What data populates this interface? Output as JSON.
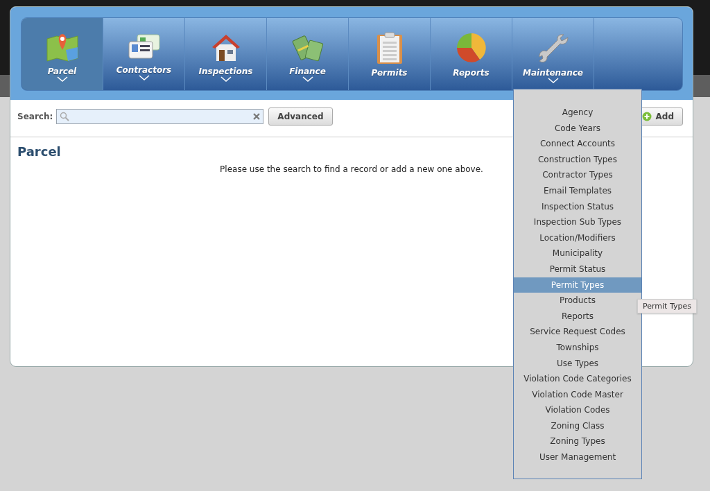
{
  "nav": [
    {
      "label": "Parcel",
      "kind": "map",
      "selected": true,
      "dropdown": true
    },
    {
      "label": "Contractors",
      "kind": "cards",
      "selected": false,
      "dropdown": true
    },
    {
      "label": "Inspections",
      "kind": "house",
      "selected": false,
      "dropdown": true
    },
    {
      "label": "Finance",
      "kind": "money",
      "selected": false,
      "dropdown": true
    },
    {
      "label": "Permits",
      "kind": "clipboard",
      "selected": false,
      "dropdown": false
    },
    {
      "label": "Reports",
      "kind": "pie",
      "selected": false,
      "dropdown": false
    },
    {
      "label": "Maintenance",
      "kind": "wrench",
      "selected": false,
      "dropdown": true
    }
  ],
  "search": {
    "label": "Search:",
    "advanced": "Advanced",
    "add": "Add"
  },
  "section": {
    "title": "Parcel",
    "message": "Please use the search to find a record or add a new one above."
  },
  "menu": [
    {
      "label": "Agency",
      "selected": false
    },
    {
      "label": "Code Years",
      "selected": false
    },
    {
      "label": "Connect Accounts",
      "selected": false
    },
    {
      "label": "Construction Types",
      "selected": false
    },
    {
      "label": "Contractor Types",
      "selected": false
    },
    {
      "label": "Email Templates",
      "selected": false
    },
    {
      "label": "Inspection Status",
      "selected": false
    },
    {
      "label": "Inspection Sub Types",
      "selected": false
    },
    {
      "label": "Location/Modifiers",
      "selected": false
    },
    {
      "label": "Municipality",
      "selected": false
    },
    {
      "label": "Permit Status",
      "selected": false
    },
    {
      "label": "Permit Types",
      "selected": true
    },
    {
      "label": "Products",
      "selected": false
    },
    {
      "label": "Reports",
      "selected": false
    },
    {
      "label": "Service Request Codes",
      "selected": false
    },
    {
      "label": "Townships",
      "selected": false
    },
    {
      "label": "Use Types",
      "selected": false
    },
    {
      "label": "Violation Code Categories",
      "selected": false
    },
    {
      "label": "Violation Code Master",
      "selected": false
    },
    {
      "label": "Violation Codes",
      "selected": false
    },
    {
      "label": "Zoning Class",
      "selected": false
    },
    {
      "label": "Zoning Types",
      "selected": false
    },
    {
      "label": "User Management",
      "selected": false
    }
  ],
  "tooltip": "Permit Types"
}
